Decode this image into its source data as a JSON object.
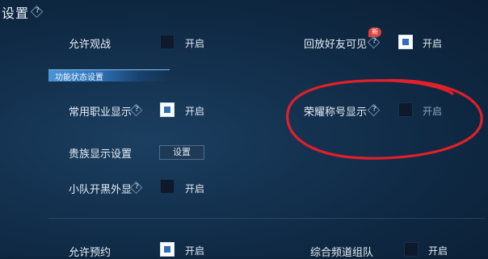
{
  "header": {
    "title": "设置"
  },
  "section": {
    "label": "功能状态设置"
  },
  "settings": {
    "allow_spectate": {
      "label": "允许观战",
      "on": "开启",
      "checked": false
    },
    "replay_friends": {
      "label": "回放好友可见",
      "on": "开启",
      "checked": true,
      "badge": "新"
    },
    "common_role": {
      "label": "常用职业显示",
      "on": "开启",
      "checked": true
    },
    "honor_title": {
      "label": "荣耀称号显示",
      "on": "开启",
      "checked": false
    },
    "noble_display": {
      "label": "贵族显示设置",
      "button": "设置"
    },
    "team_outer_display": {
      "label": "小队开黑外显",
      "on": "开启",
      "checked": false
    },
    "allow_reserve": {
      "label": "允许预约",
      "on": "开启",
      "checked": true
    },
    "channel_team": {
      "label": "综合频道组队",
      "on": "开启",
      "checked": false
    }
  },
  "colors": {
    "annotation_circle": "#e0202a",
    "accent": "#2f6fb8"
  }
}
